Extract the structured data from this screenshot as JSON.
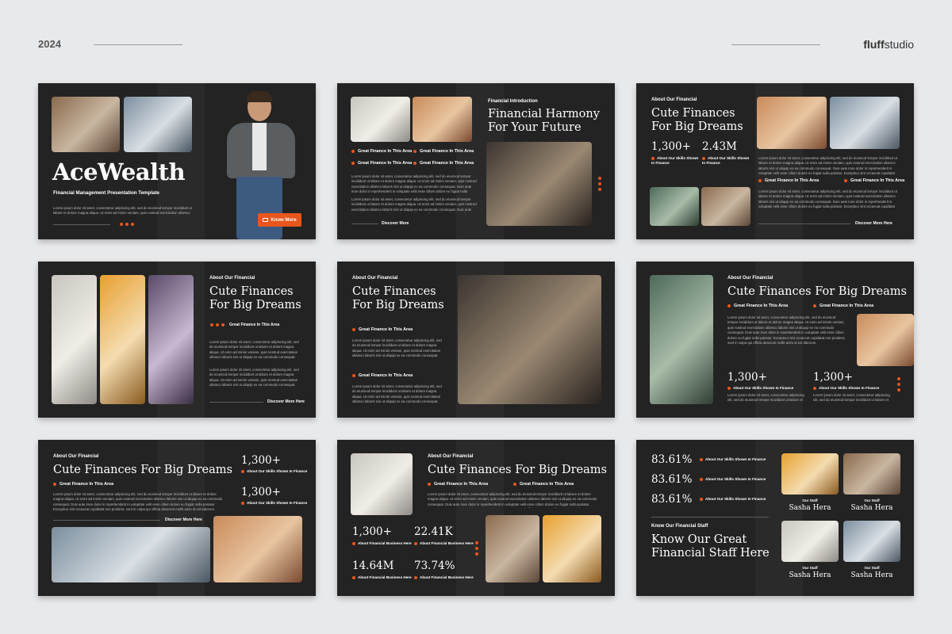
{
  "header": {
    "year": "2024",
    "brand_bold": "fluff",
    "brand_rest": "studio"
  },
  "accent_color": "#e8561c",
  "para": "Lorem ipsum dolor sit amet, consectetur adipiscing elit, sed do eiusmod tempor incididunt ut labore et dolore magna aliqua. Ut enim ad minim veniam, quis nostrud exercitation ullamco laboris nisi ut aliquip ex ea commodo consequat. Duis aute irure dolor in reprehenderit in voluptate velit esse cillum dolore eu fugiat nulla pariatur. Excepteur sint occaecat cupidatat non proident, sunt in culpa qui officia deserunt mollit anim id est laborum.",
  "para_short": "Lorem ipsum dolor sit amet, consectetur adipiscing elit, sed do eiusmod tempor incididunt ut labore et dolore magna aliqua. Ut enim ad minim veniam, quis nostrud exercitation ullamco laboris nisi ut aliquip ex ea commodo consequat.",
  "s1": {
    "title": "AceWealth",
    "subtitle": "Financial Management Presentation Template",
    "button": "Know More",
    "button_icon": "presentation-icon"
  },
  "s2": {
    "kicker": "Financial Introduction",
    "title1": "Financial Harmony",
    "title2": "For Your Future",
    "bullet": "Great Finance In This Area",
    "link": "Discover More"
  },
  "s3": {
    "kicker": "About Our Financial",
    "title1": "Cute Finances",
    "title2": "For Big Dreams",
    "stat1": "1,300+",
    "stat2": "2.43M",
    "cap": "About Our Skills Shown In Finance",
    "bullet": "Great Finance In This Area",
    "link": "Discover More Here"
  },
  "s4": {
    "kicker": "About Our Financial",
    "title1": "Cute Finances",
    "title2": "For Big Dreams",
    "bullet": "Great Finance In This Area",
    "link": "Discover More Here"
  },
  "s5": {
    "kicker": "About Our Financial",
    "title1": "Cute Finances",
    "title2": "For Big Dreams",
    "bullet": "Great Finance In This Area"
  },
  "s6": {
    "kicker": "About Our Financial",
    "title": "Cute Finances For Big Dreams",
    "bullet": "Great Finance In This Area",
    "stat": "1,300+",
    "cap": "About Our Skills Shown In Finance"
  },
  "s7": {
    "kicker": "About Our Financial",
    "title": "Cute Finances For Big Dreams",
    "bullet": "Great Finance In This Area",
    "stat": "1,300+",
    "cap": "About Our Skills Shown In Finance",
    "link": "Discover More Here"
  },
  "s8": {
    "kicker": "About Our Financial",
    "title": "Cute Finances For Big Dreams",
    "bullet": "Great Finance In This Area",
    "stats": [
      "1,300+",
      "22.41K",
      "14.64M",
      "73.74%"
    ],
    "cap": "About Financial Business Here"
  },
  "s9": {
    "pct": "83.61%",
    "cap": "About Our Skills Shown In Finance",
    "kicker": "Know Our Financial Staff",
    "title1": "Know Our Great",
    "title2": "Financial Staff Here",
    "role": "Our Staff",
    "name": "Sasha Hera"
  }
}
